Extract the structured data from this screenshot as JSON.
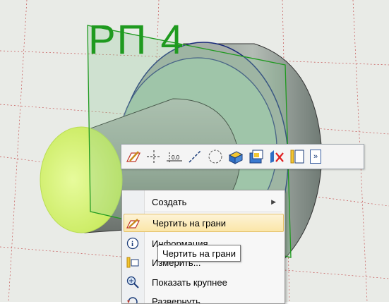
{
  "plane_label": "РП 4",
  "toolbar": {
    "buttons": [
      {
        "icon": "sketch-on-face-icon"
      },
      {
        "icon": "axis-cross-icon"
      },
      {
        "icon": "dimension-icon"
      },
      {
        "icon": "line-icon"
      },
      {
        "icon": "circle-icon"
      },
      {
        "icon": "extrude-icon"
      },
      {
        "icon": "cut-icon"
      },
      {
        "icon": "delete-icon"
      },
      {
        "icon": "hide-icon"
      }
    ],
    "more_label": "»"
  },
  "context_menu": {
    "items": [
      {
        "label": "Создать",
        "icon": "none",
        "submenu": true
      },
      {
        "label": "Чертить на грани",
        "icon": "sketch-on-face-icon",
        "highlighted": true
      },
      {
        "label": "Информация",
        "icon": "info-icon"
      },
      {
        "label": "Измерить...",
        "icon": "measure-icon"
      },
      {
        "label": "Показать крупнее",
        "icon": "zoom-icon"
      },
      {
        "label": "Развернуть",
        "icon": "rotate-icon"
      }
    ]
  },
  "tooltip": {
    "text": "Чертить на грани"
  },
  "colors": {
    "background": "#e9ebe7",
    "plane_green": "#1f9a1f",
    "face_highlight": "#d8f27a",
    "menu_highlight": "#fbe6a8"
  }
}
